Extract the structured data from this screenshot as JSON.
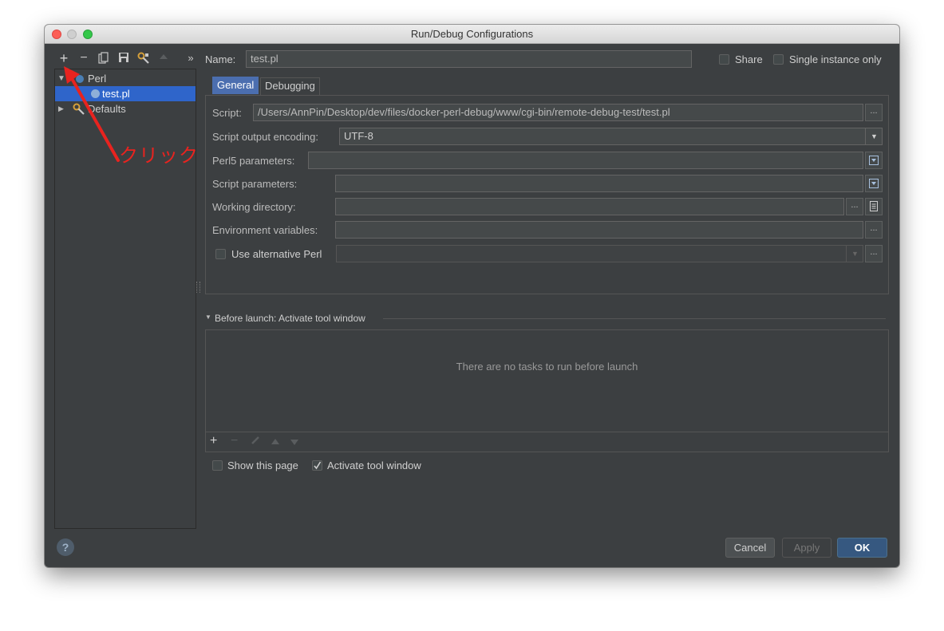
{
  "window": {
    "title": "Run/Debug Configurations"
  },
  "toolbar": {
    "add": "+",
    "remove": "−",
    "overflow": "»"
  },
  "tree": {
    "perl_label": "Perl",
    "test_label": "test.pl",
    "defaults_label": "Defaults"
  },
  "annotation": {
    "text": "クリック",
    "color": "#e8231f"
  },
  "header": {
    "name_label": "Name:",
    "name_value": "test.pl",
    "share_label": "Share",
    "single_instance_label": "Single instance only"
  },
  "tabs": {
    "general": "General",
    "debugging": "Debugging"
  },
  "form": {
    "script_label": "Script:",
    "script_value": "/Users/AnnPin/Desktop/dev/files/docker-perl-debug/www/cgi-bin/remote-debug-test/test.pl",
    "encoding_label": "Script output encoding:",
    "encoding_value": "UTF-8",
    "perl5_label": "Perl5 parameters:",
    "script_params_label": "Script parameters:",
    "working_dir_label": "Working directory:",
    "env_vars_label": "Environment variables:",
    "alt_perl_label": "Use alternative Perl",
    "ellipsis": "..."
  },
  "before_launch": {
    "title": "Before launch: Activate tool window",
    "empty_text": "There are no tasks to run before launch",
    "show_page_label": "Show this page",
    "activate_label": "Activate tool window"
  },
  "buttons": {
    "help": "?",
    "cancel": "Cancel",
    "apply": "Apply",
    "ok": "OK"
  },
  "colors": {
    "background": "#3c3f41",
    "field": "#45494a",
    "selection": "#2f65ca",
    "ok_button": "#365880"
  }
}
